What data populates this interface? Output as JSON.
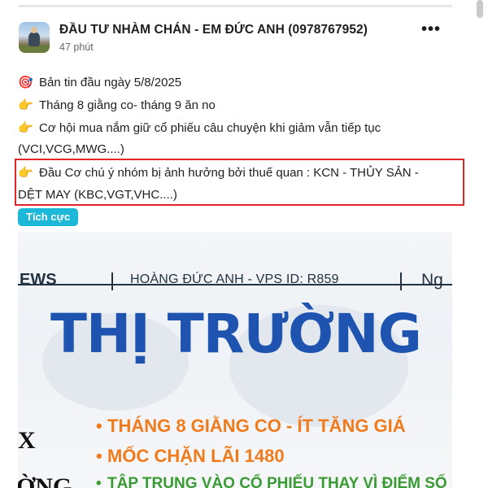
{
  "post": {
    "author": "ĐẦU TƯ NHÀM CHÁN - EM ĐỨC ANH (0978767952)",
    "time": "47 phút",
    "more_label": "•••",
    "lines": [
      {
        "icon": "🎯",
        "text": "Bản tin đầu ngày 5/8/2025"
      },
      {
        "icon": "👉",
        "text": "Tháng 8 giằng co- tháng 9 ăn no"
      },
      {
        "icon": "👉",
        "text": "Cơ hội mua nắm giữ cổ phiếu câu chuyện khi giảm vẫn tiếp tục"
      },
      {
        "icon": "",
        "text": "(VCI,VCG,MWG....)"
      },
      {
        "icon": "👉",
        "text": "Đầu Cơ chú ý nhóm bị ảnh hưởng bởi thuế quan : KCN - THỦY SẢN -"
      },
      {
        "icon": "",
        "text": "DỆT MAY (KBC,VGT,VHC....)"
      }
    ],
    "tag": "Tích cực",
    "highlight_color": "#e0262b",
    "tag_color": "#1db7d8"
  },
  "banner": {
    "news_left": "EWS",
    "news_mid": "HOÀNG ĐỨC ANH - VPS ID: R859",
    "news_right": "Ng",
    "title": "THỊ TRƯỜNG",
    "bullets": [
      "THÁNG 8 GIẰNG CO - ÍT TĂNG GIÁ",
      "MỐC CHẶN LÃI 1480",
      "TẬP TRUNG VÀO CỔ PHIẾU THAY VÌ ĐIỂM SỐ (KE"
    ],
    "side_left_top": "X",
    "side_left_bottom": "ỜNG",
    "title_color": "#1e54b0",
    "bullet_color": "#f07b1d"
  }
}
